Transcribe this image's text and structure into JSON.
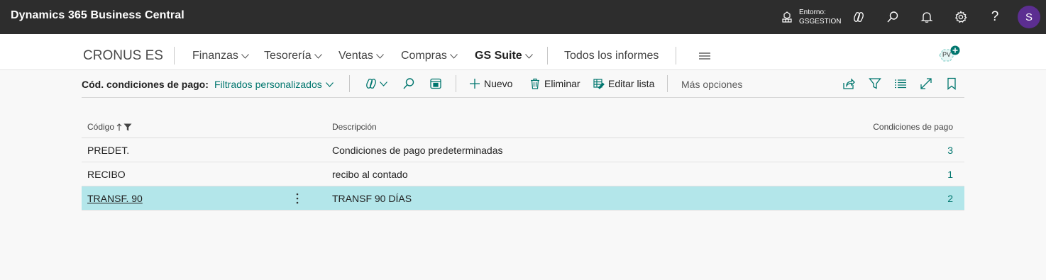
{
  "app": {
    "title": "Dynamics 365 Business Central"
  },
  "environment": {
    "label": "Entorno:",
    "value": "GSGESTION"
  },
  "topbar": {
    "icons": [
      "environment-icon",
      "copilot-icon",
      "search-icon",
      "bell-icon",
      "gear-icon",
      "help-icon"
    ],
    "help_glyph": "?",
    "avatar_initial": "S",
    "avatar_color": "#5c2e91"
  },
  "nav": {
    "company": "CRONUS ES",
    "items": [
      {
        "label": "Finanzas"
      },
      {
        "label": "Tesorería"
      },
      {
        "label": "Ventas"
      },
      {
        "label": "Compras"
      },
      {
        "label": "GS Suite"
      },
      {
        "label": "Todos los informes"
      }
    ],
    "badge": "PV"
  },
  "actionbar": {
    "page_label": "Cód. condiciones de pago:",
    "filter_label": "Filtrados personalizados",
    "new_label": "Nuevo",
    "delete_label": "Eliminar",
    "edit_list_label": "Editar lista",
    "more_options_label": "Más opciones"
  },
  "table": {
    "columns": {
      "code": "Código",
      "description": "Descripción",
      "payment_terms": "Condiciones de pago"
    },
    "rows": [
      {
        "code": "PREDET.",
        "description": "Condiciones de pago predeterminadas",
        "terms": "3"
      },
      {
        "code": "RECIBO",
        "description": "recibo al contado",
        "terms": "1"
      },
      {
        "code": "TRANSF. 90",
        "description": "TRANSF 90 DÍAS",
        "terms": "2"
      }
    ],
    "selected_row": 2
  },
  "colors": {
    "topbar": "#2d2d2d",
    "accent": "#00766e",
    "selected_row": "#b3e6ea"
  }
}
